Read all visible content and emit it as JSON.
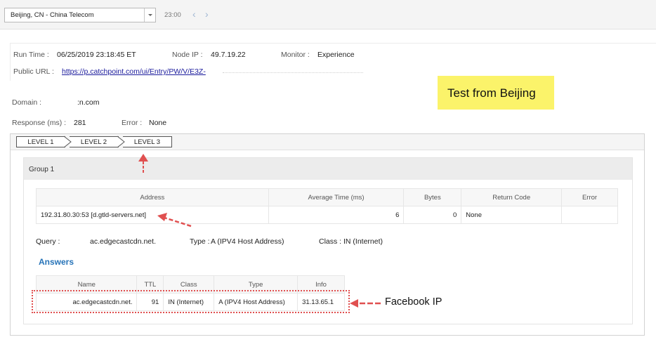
{
  "topbar": {
    "location_select": "Beijing, CN - China Telecom",
    "time": "23:00",
    "prev_icon": "chevron-left-icon",
    "next_icon": "chevron-right-icon"
  },
  "run_info": {
    "run_time_label": "Run Time :",
    "run_time_value": "06/25/2019 23:18:45 ET",
    "node_ip_label": "Node IP :",
    "node_ip_value": "49.7.19.22",
    "monitor_label": "Monitor :",
    "monitor_value": "Experience",
    "public_url_label": "Public URL :",
    "public_url_value": "https://p.catchpoint.com/ui/Entry/PW/V/E3Z-"
  },
  "callout": "Test from Beijing",
  "summary": {
    "domain_label": "Domain :",
    "domain_value": ":n.com",
    "response_label": "Response (ms) :",
    "response_value": "281",
    "error_label": "Error :",
    "error_value": "None"
  },
  "levels": [
    "LEVEL 1",
    "LEVEL 2",
    "LEVEL 3"
  ],
  "group": {
    "title": "Group 1",
    "servers_table": {
      "headers": [
        "Address",
        "Average Time (ms)",
        "Bytes",
        "Return Code",
        "Error"
      ],
      "rows": [
        [
          "192.31.80.30:53 [d.gtld-servers.net]",
          "6",
          "0",
          "None",
          ""
        ]
      ]
    },
    "query": {
      "query_label": "Query :",
      "query_value": "ac.edgecastcdn.net.",
      "type_label": "Type :",
      "type_value": "A (IPV4 Host Address)",
      "class_label": "Class :",
      "class_value": "IN (Internet)"
    },
    "answers_title": "Answers",
    "answers_table": {
      "headers": [
        "Name",
        "TTL",
        "Class",
        "Type",
        "Info"
      ],
      "rows": [
        [
          "ac.edgecastcdn.net.",
          "91",
          "IN (Internet)",
          "A (IPV4 Host Address)",
          "31.13.65.1"
        ]
      ]
    }
  },
  "annotation_label": "Facebook IP",
  "colors": {
    "callout_bg": "#fbf36a",
    "annotation_red": "#e05050",
    "answers_blue": "#2673b8",
    "link": "#1a1a9c"
  }
}
